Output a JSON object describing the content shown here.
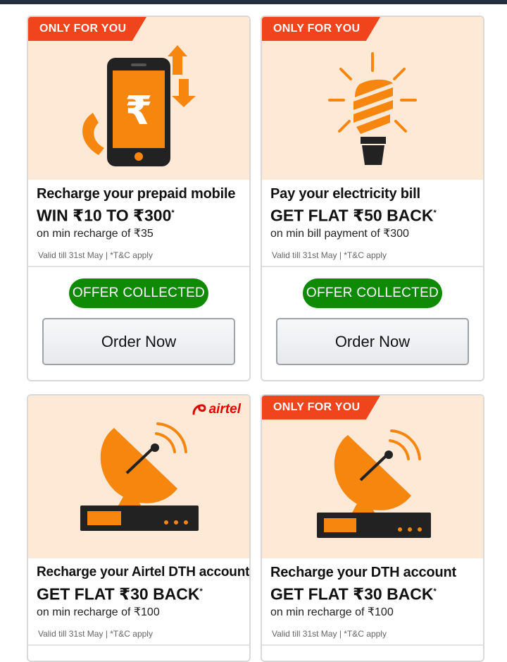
{
  "cards": [
    {
      "ribbon": "ONLY FOR YOU",
      "title": "Recharge your prepaid mobile",
      "headline": "WIN ₹10 TO ₹300",
      "asterisk": "*",
      "subtext": "on min recharge of ₹35",
      "validity": "Valid till 31st May | *T&C apply",
      "status": "OFFER COLLECTED",
      "button": "Order Now",
      "icon": "mobile-recharge-icon"
    },
    {
      "ribbon": "ONLY FOR YOU",
      "title": "Pay your electricity bill",
      "headline": "GET FLAT ₹50 BACK",
      "asterisk": "*",
      "subtext": "on min bill payment of ₹300",
      "validity": "Valid till 31st May | *T&C apply",
      "status": "OFFER COLLECTED",
      "button": "Order Now",
      "icon": "light-bulb-icon"
    },
    {
      "brand": "airtel",
      "title": "Recharge your Airtel DTH account",
      "headline": "GET FLAT ₹30 BACK",
      "asterisk": "*",
      "subtext": "on min recharge of ₹100",
      "validity": "Valid till 31st May | *T&C apply",
      "icon": "satellite-dish-icon"
    },
    {
      "ribbon": "ONLY FOR YOU",
      "title": "Recharge your DTH account",
      "headline": "GET FLAT ₹30 BACK",
      "asterisk": "*",
      "subtext": "on min recharge of ₹100",
      "validity": "Valid till 31st May | *T&C apply",
      "icon": "satellite-dish-icon"
    }
  ],
  "colors": {
    "accent_orange": "#f7860f",
    "ribbon_red": "#f0441d",
    "collected_green": "#0f8a05",
    "banner_bg": "#fde9d6"
  }
}
